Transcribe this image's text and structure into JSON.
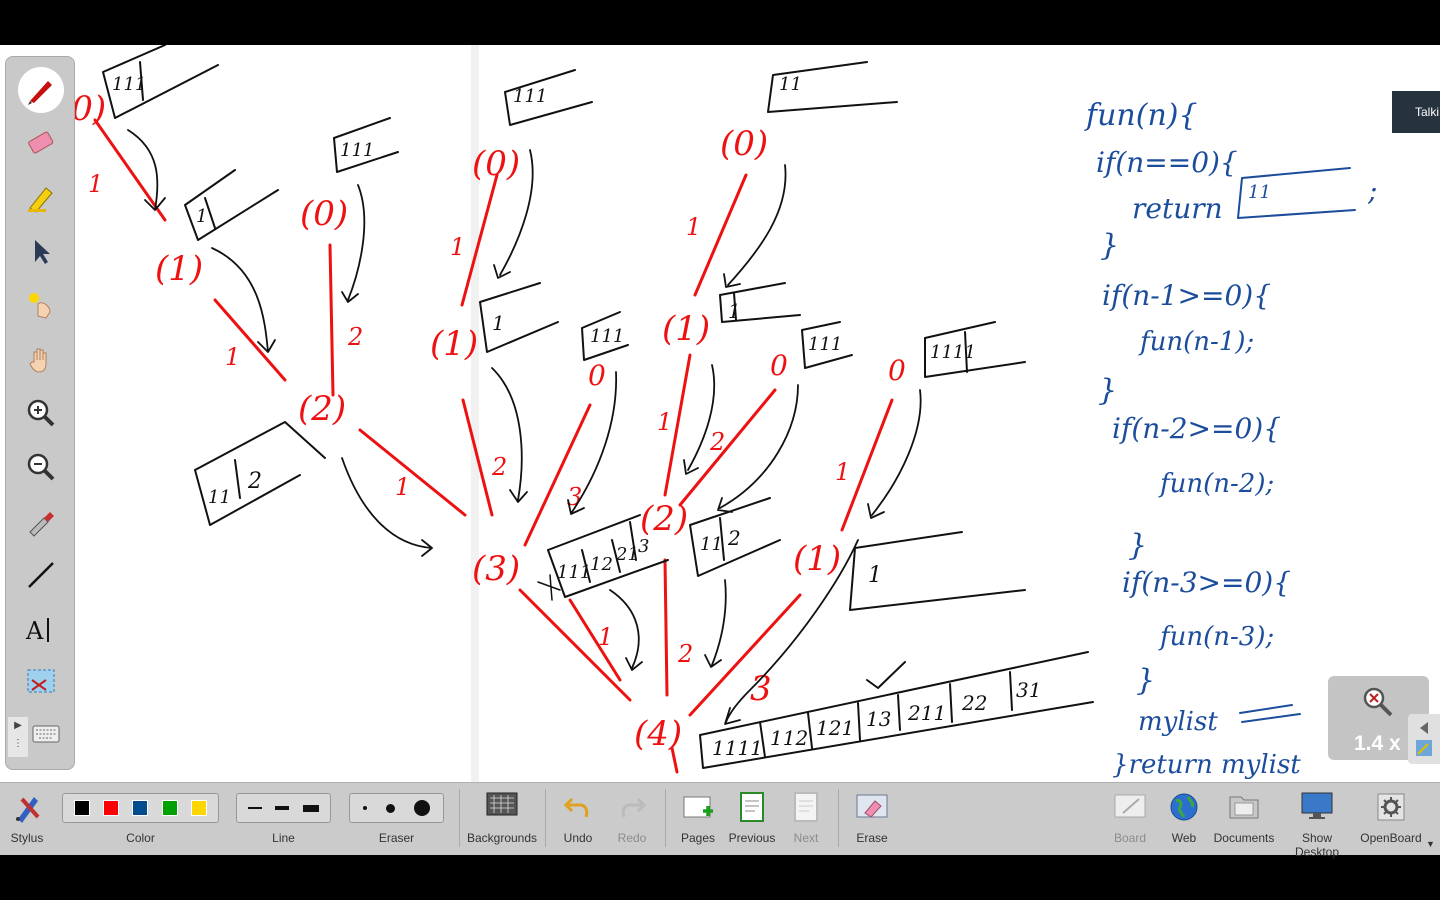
{
  "zoom": {
    "value": "1.4 x"
  },
  "talk_badge": "Talki",
  "toolbar": {
    "stylus": "Stylus",
    "color": "Color",
    "line": "Line",
    "eraser": "Eraser",
    "backgrounds": "Backgrounds",
    "undo": "Undo",
    "redo": "Redo",
    "pages": "Pages",
    "previous": "Previous",
    "next": "Next",
    "erase": "Erase",
    "board": "Board",
    "web": "Web",
    "documents": "Documents",
    "show_desktop": "Show Desktop",
    "openboard": "OpenBoard"
  },
  "colors": [
    "#000000",
    "#ff0000",
    "#004c8c",
    "#00a000",
    "#ffd500"
  ],
  "tools": [
    "pen-icon",
    "eraser-icon",
    "highlighter-icon",
    "pointer-icon",
    "laser-icon",
    "hand-icon",
    "zoom-in-icon",
    "zoom-out-icon",
    "picker-icon",
    "line-icon",
    "text-icon",
    "capture-icon"
  ],
  "ink": {
    "code": [
      "fun(n){",
      "if(n==0){",
      "return",
      "\"1\"",
      ";",
      "}",
      "if(n-1>=0){",
      "fun(n-1);",
      "}",
      "if(n-2>=0){",
      "fun(n-2);",
      "}",
      "if(n-3>=0){",
      "fun(n-3);",
      "}",
      "mylist ==",
      "}return mylist"
    ],
    "nodes": [
      "0",
      "1",
      "2",
      "0",
      "1",
      "3",
      "0",
      "1",
      "2",
      "0",
      "1",
      "4"
    ],
    "edge_labels": [
      "1",
      "1",
      "2",
      "1",
      "2",
      "3",
      "1",
      "2",
      "1",
      "2",
      "3",
      "1",
      "2",
      "3"
    ],
    "boxes": [
      "\"1\"",
      "\"11\"",
      "\"1\"",
      "111",
      "\"1\"",
      "1",
      "\"111\"",
      "111",
      "\"1\"",
      "\"1\"",
      "1",
      "\"11\"",
      "11|2",
      "11|2",
      "111|12|21|3",
      "1111|112|121|13|211|22|31"
    ]
  }
}
